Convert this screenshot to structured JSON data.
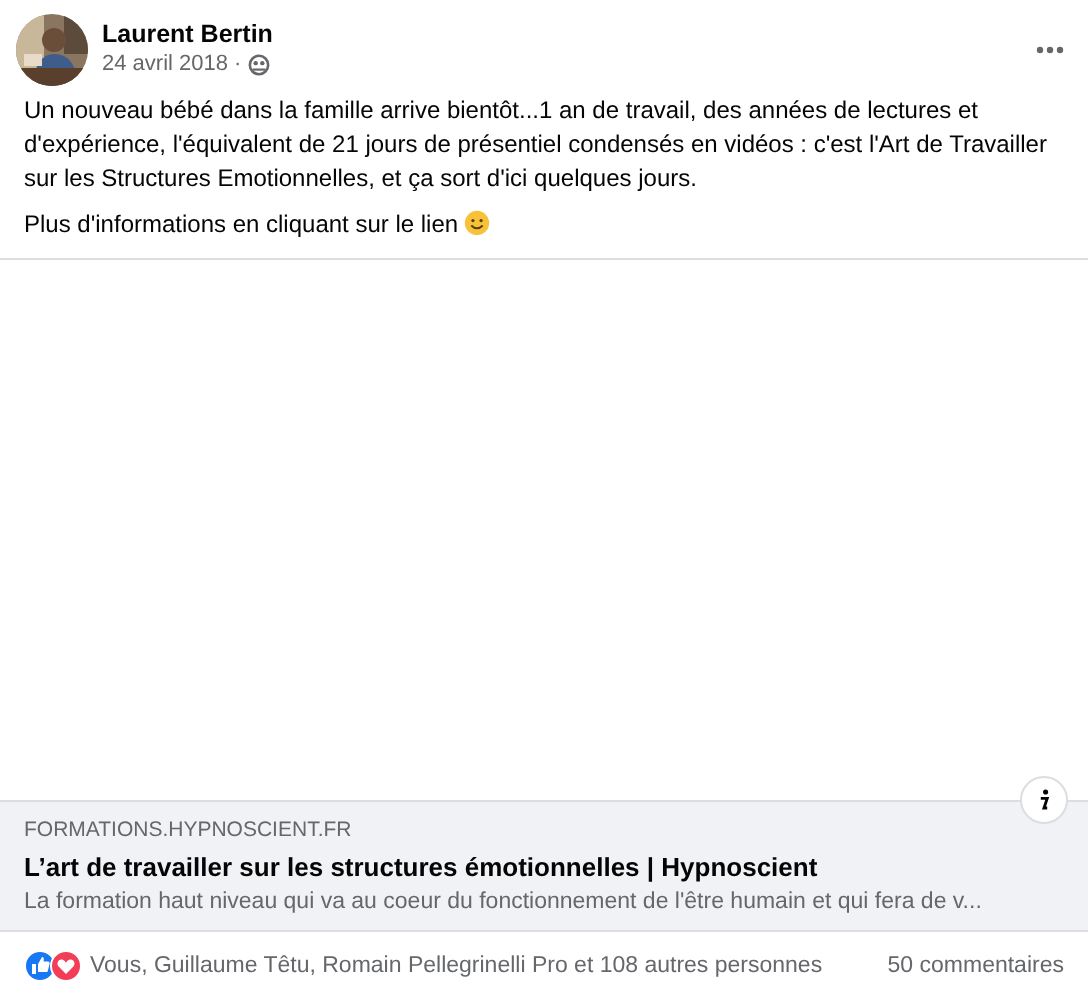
{
  "post": {
    "author": "Laurent Bertin",
    "date": "24 avril 2018",
    "separator": "·",
    "paragraphs": [
      "Un nouveau bébé dans la famille arrive bientôt...1 an de travail, des années de lectures et d'expérience, l'équivalent de 21 jours de présentiel condensés en vidéos : c'est l'Art de Travailler sur les Structures Emotionnelles, et ça sort d'ici quelques jours.",
      "Plus d'informations en cliquant sur le lien"
    ]
  },
  "link_preview": {
    "domain": "FORMATIONS.HYPNOSCIENT.FR",
    "title": "L’art de travailler sur les structures émotionnelles | Hypnoscient",
    "description": "La formation haut niveau qui va au coeur du fonctionnement de l'être humain et qui fera de v..."
  },
  "reactions": {
    "summary": "Vous, Guillaume Têtu, Romain Pellegrinelli Pro et 108 autres personnes",
    "comments": "50 commentaires"
  }
}
